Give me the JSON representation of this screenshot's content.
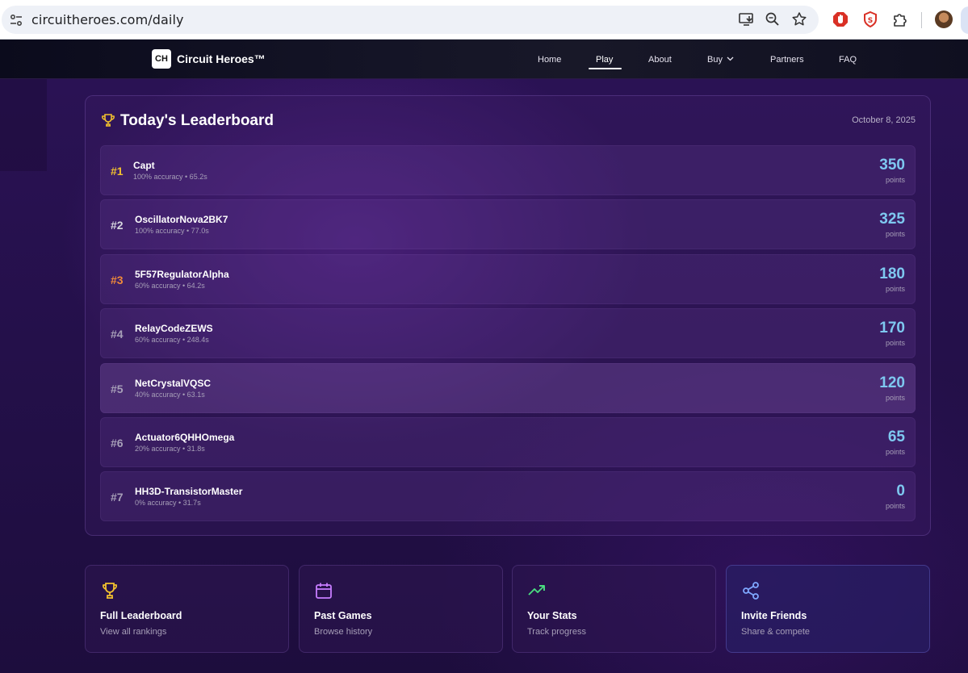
{
  "browser": {
    "url": "circuitheroes.com/daily"
  },
  "nav": {
    "logo_mark": "CH",
    "brand": "Circuit Heroes™",
    "links": [
      {
        "label": "Home"
      },
      {
        "label": "Play",
        "active": true
      },
      {
        "label": "About"
      },
      {
        "label": "Buy",
        "dropdown": true
      },
      {
        "label": "Partners"
      },
      {
        "label": "FAQ"
      }
    ]
  },
  "leaderboard": {
    "title": "Today's Leaderboard",
    "title_icon": "trophy-icon",
    "date": "October 8, 2025",
    "points_label": "points",
    "rows": [
      {
        "rank": "#1",
        "name": "Capt",
        "meta": "100% accuracy • 65.2s",
        "score": "350",
        "rank_color": "#f2c12e"
      },
      {
        "rank": "#2",
        "name": "OscillatorNova2BK7",
        "meta": "100% accuracy • 77.0s",
        "score": "325",
        "rank_color": "#d7d7df"
      },
      {
        "rank": "#3",
        "name": "5F57RegulatorAlpha",
        "meta": "60% accuracy • 64.2s",
        "score": "180",
        "rank_color": "#f08a3a"
      },
      {
        "rank": "#4",
        "name": "RelayCodeZEWS",
        "meta": "60% accuracy • 248.4s",
        "score": "170",
        "rank_color": "#a79fb8"
      },
      {
        "rank": "#5",
        "name": "NetCrystalVQSC",
        "meta": "40% accuracy • 63.1s",
        "score": "120",
        "rank_color": "#a79fb8"
      },
      {
        "rank": "#6",
        "name": "Actuator6QHHOmega",
        "meta": "20% accuracy • 31.8s",
        "score": "65",
        "rank_color": "#a79fb8"
      },
      {
        "rank": "#7",
        "name": "HH3D-TransistorMaster",
        "meta": "0% accuracy • 31.7s",
        "score": "0",
        "rank_color": "#a79fb8"
      }
    ]
  },
  "cards": [
    {
      "title": "Full Leaderboard",
      "subtitle": "View all rankings",
      "icon": "trophy-icon",
      "icon_color": "#f2c12e"
    },
    {
      "title": "Past Games",
      "subtitle": "Browse history",
      "icon": "calendar-icon",
      "icon_color": "#c77dff"
    },
    {
      "title": "Your Stats",
      "subtitle": "Track progress",
      "icon": "trending-up-icon",
      "icon_color": "#4ade80"
    },
    {
      "title": "Invite Friends",
      "subtitle": "Share & compete",
      "icon": "share-icon",
      "icon_color": "#7fa8ff"
    }
  ],
  "colors": {
    "score": "#7ec8f0",
    "background": "#24104a"
  }
}
